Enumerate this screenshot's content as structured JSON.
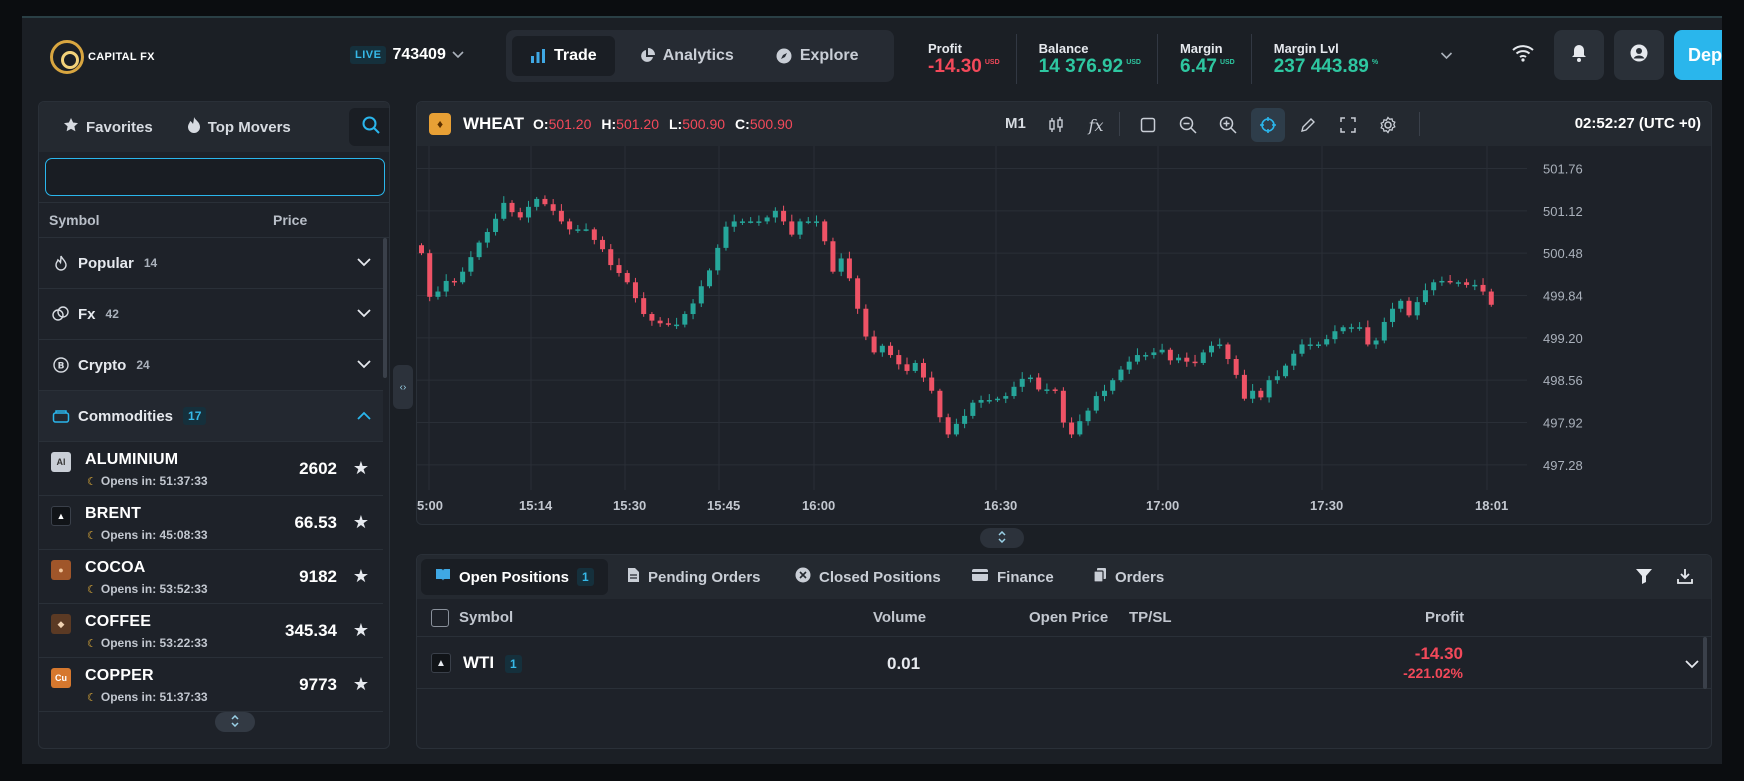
{
  "app": {
    "logo_text": "CAPITAL FX"
  },
  "account": {
    "mode": "LIVE",
    "id": "743409"
  },
  "nav": {
    "trade": "Trade",
    "analytics": "Analytics",
    "explore": "Explore"
  },
  "stats": [
    {
      "label": "Profit",
      "value": "-14.30",
      "unit": "USD",
      "color": "#f3495a"
    },
    {
      "label": "Balance",
      "value": "14 376.92",
      "unit": "USD",
      "color": "#2ec7a1"
    },
    {
      "label": "Margin",
      "value": "6.47",
      "unit": "USD",
      "color": "#2ec7a1"
    },
    {
      "label": "Margin Lvl",
      "value": "237 443.89",
      "unit": "%",
      "color": "#2ec7a1"
    }
  ],
  "deposit_label": "Deposit",
  "left_panel": {
    "tabs": {
      "favorites": "Favorites",
      "top_movers": "Top Movers"
    },
    "search": {
      "value": "",
      "placeholder": ""
    },
    "columns": {
      "symbol": "Symbol",
      "price": "Price"
    },
    "categories": [
      {
        "name": "Popular",
        "count": "14",
        "icon": "flame-outline-icon"
      },
      {
        "name": "Fx",
        "count": "42",
        "icon": "coins-icon"
      },
      {
        "name": "Crypto",
        "count": "24",
        "icon": "bitcoin-icon"
      },
      {
        "name": "Commodities",
        "count": "17",
        "icon": "commodities-icon"
      }
    ],
    "symbols": [
      {
        "name": "ALUMINIUM",
        "badge": "Al",
        "opens_in": "Opens in: 51:37:33",
        "price": "2602",
        "icon_bg": "#c9ced6",
        "icon_fg": "#333"
      },
      {
        "name": "BRENT",
        "badge": "▲",
        "opens_in": "Opens in: 45:08:33",
        "price": "66.53",
        "icon_bg": "#111418",
        "icon_fg": "#fff"
      },
      {
        "name": "COCOA",
        "badge": "●",
        "opens_in": "Opens in: 53:52:33",
        "price": "9182",
        "icon_bg": "#a0562a",
        "icon_fg": "#f2c59a"
      },
      {
        "name": "COFFEE",
        "badge": "◆",
        "opens_in": "Opens in: 53:22:33",
        "price": "345.34",
        "icon_bg": "#5b3a24",
        "icon_fg": "#f0d2b2"
      },
      {
        "name": "COPPER",
        "badge": "Cu",
        "opens_in": "Opens in: 51:37:33",
        "price": "9773",
        "icon_bg": "#d6782e",
        "icon_fg": "#fff"
      }
    ]
  },
  "chart_panel": {
    "symbol": "WHEAT",
    "ohlc": {
      "o_label": "O:",
      "o": "501.20",
      "h_label": "H:",
      "h": "501.20",
      "l_label": "L:",
      "l": "500.90",
      "c_label": "C:",
      "c": "500.90"
    },
    "timeframe": "M1",
    "clock": "02:52:27 (UTC +0)"
  },
  "chart_data": {
    "type": "candlestick",
    "x_ticks": [
      "5:00",
      "15:14",
      "15:30",
      "15:45",
      "16:00",
      "16:30",
      "17:00",
      "17:30",
      "18:01"
    ],
    "y_ticks": [
      "501.76",
      "501.12",
      "500.48",
      "499.84",
      "499.20",
      "498.56",
      "497.92",
      "497.28"
    ],
    "ylim": [
      496.9,
      502.1
    ],
    "grid": true,
    "up_color": "#26a69a",
    "down_color": "#ef5366",
    "closes": [
      500.48,
      499.82,
      499.9,
      500.06,
      500.04,
      500.2,
      500.42,
      500.64,
      500.8,
      501.0,
      501.24,
      501.1,
      501.02,
      501.18,
      501.3,
      501.22,
      501.12,
      500.96,
      500.84,
      500.84,
      500.84,
      500.68,
      500.54,
      500.3,
      500.18,
      500.04,
      499.8,
      499.56,
      499.46,
      499.42,
      499.4,
      499.4,
      499.56,
      499.72,
      499.98,
      500.22,
      500.56,
      500.88,
      500.96,
      500.96,
      500.96,
      500.96,
      501.02,
      501.12,
      500.96,
      500.76,
      500.96,
      500.96,
      500.96,
      500.66,
      500.2,
      500.4,
      500.1,
      499.64,
      499.22,
      498.98,
      499.08,
      498.94,
      498.8,
      498.7,
      498.82,
      498.6,
      498.4,
      498.0,
      497.74,
      497.9,
      498.02,
      498.22,
      498.26,
      498.26,
      498.28,
      498.32,
      498.46,
      498.58,
      498.6,
      498.42,
      498.42,
      498.4,
      497.92,
      497.74,
      497.94,
      498.1,
      498.32,
      498.4,
      498.56,
      498.72,
      498.84,
      498.94,
      498.94,
      498.98,
      499.02,
      498.86,
      498.9,
      498.84,
      498.82,
      498.98,
      499.08,
      499.1,
      498.88,
      498.64,
      498.28,
      498.4,
      498.3,
      498.56,
      498.62,
      498.78,
      498.96,
      499.1,
      499.1,
      499.1,
      499.18,
      499.3,
      499.36,
      499.36,
      499.36,
      499.1,
      499.16,
      499.44,
      499.64,
      499.76,
      499.54,
      499.74,
      499.92,
      500.04,
      500.06,
      500.04,
      500.04,
      500.0,
      500.0,
      499.9,
      499.7
    ]
  },
  "positions_panel": {
    "tabs": [
      {
        "label": "Open Positions",
        "count": "1"
      },
      {
        "label": "Pending Orders"
      },
      {
        "label": "Closed Positions"
      },
      {
        "label": "Finance"
      },
      {
        "label": "Orders"
      }
    ],
    "columns": {
      "symbol": "Symbol",
      "volume": "Volume",
      "open_price": "Open Price",
      "tpsl": "TP/SL",
      "profit": "Profit"
    },
    "rows": [
      {
        "symbol": "WTI",
        "count": "1",
        "volume": "0.01",
        "profit": "-14.30",
        "profit_pct": "-221.02%"
      }
    ]
  }
}
